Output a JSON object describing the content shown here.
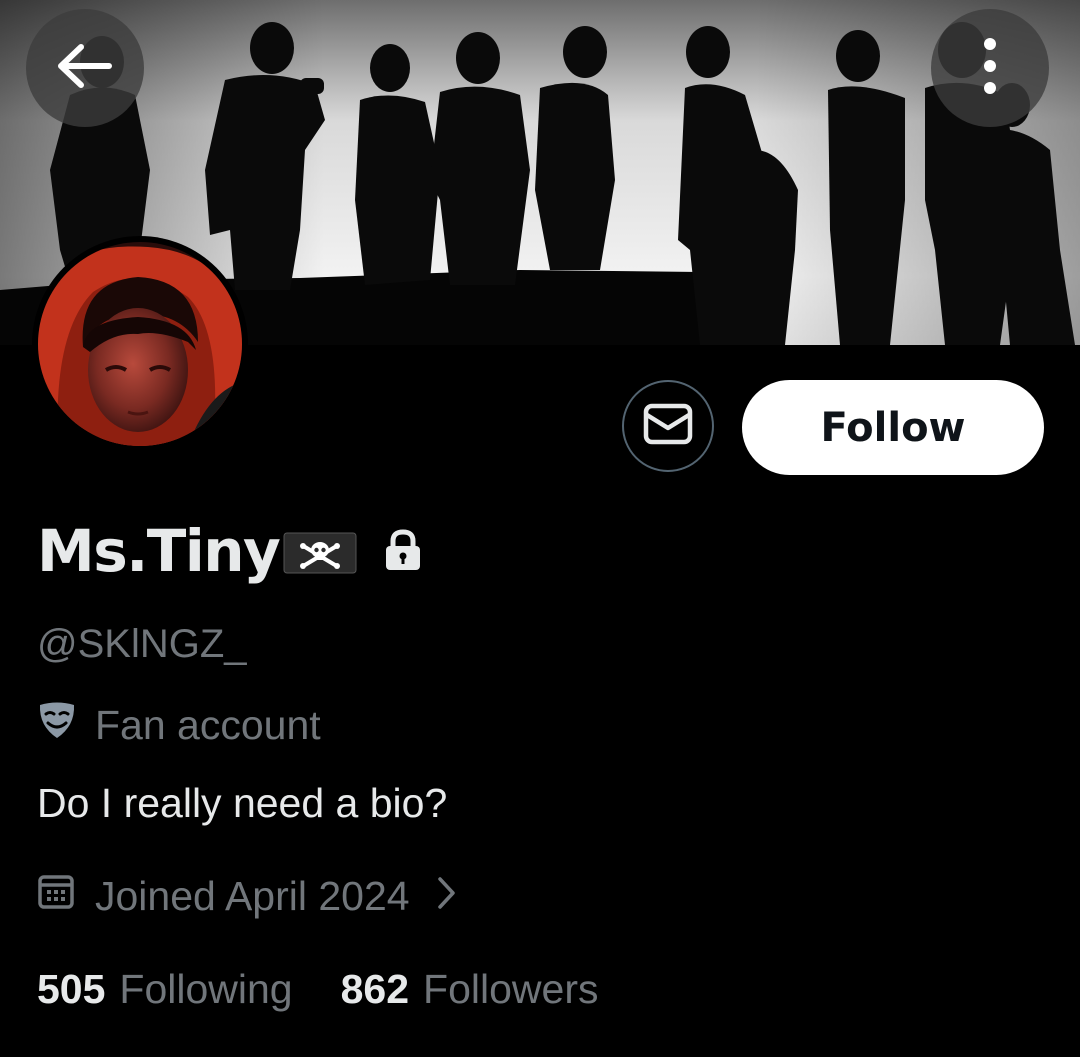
{
  "profile": {
    "display_name": "Ms.Tiny",
    "name_emoji": "pirate-flag-icon",
    "protected": true,
    "handle": "@SKlNGZ_",
    "category_label": "Fan account",
    "category_icon": "performing-arts-mask-icon",
    "bio": "Do I really need a bio?",
    "joined_text": "Joined April 2024"
  },
  "stats": {
    "following_count": "505",
    "following_label": "Following",
    "followers_count": "862",
    "followers_label": "Followers"
  },
  "actions": {
    "follow_label": "Follow",
    "back_icon": "arrow-left-icon",
    "more_icon": "more-vertical-icon",
    "message_icon": "envelope-icon"
  },
  "colors": {
    "background": "#000000",
    "primary_text": "#e7e9ea",
    "secondary_text": "#71767b",
    "button_border": "#536471",
    "follow_bg": "#ffffff",
    "follow_text": "#0f1419"
  }
}
